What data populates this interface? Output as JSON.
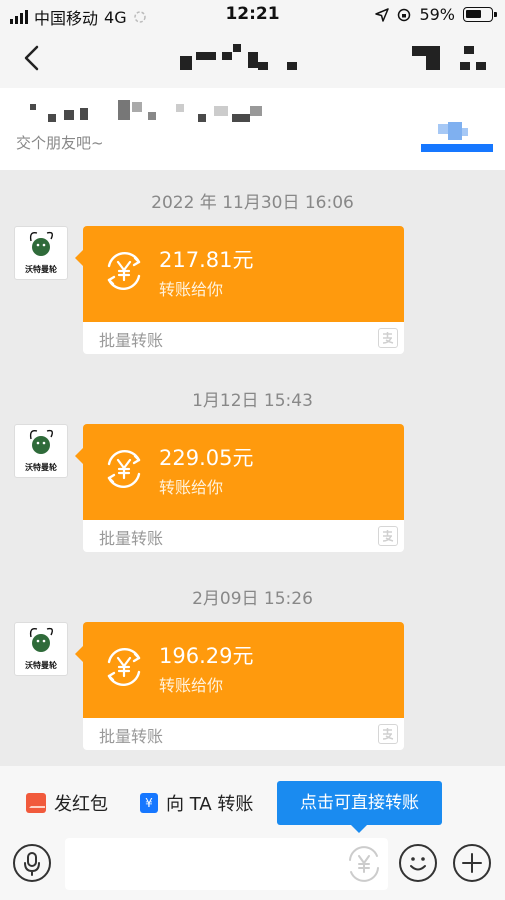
{
  "status_bar": {
    "carrier": "中国移动",
    "network": "4G",
    "time": "12:21",
    "battery": "59%"
  },
  "profile": {
    "greeting": "交个朋友吧~"
  },
  "messages": [
    {
      "timestamp": "2022 年 11月30日 16:06",
      "avatar_label": "沃特曼轮",
      "amount": "217.81元",
      "subtitle": "转账给你",
      "footer": "批量转账"
    },
    {
      "timestamp": "1月12日 15:43",
      "avatar_label": "沃特曼轮",
      "amount": "229.05元",
      "subtitle": "转账给你",
      "footer": "批量转账"
    },
    {
      "timestamp": "2月09日 15:26",
      "avatar_label": "沃特曼轮",
      "amount": "196.29元",
      "subtitle": "转账给你",
      "footer": "批量转账"
    }
  ],
  "actions": {
    "red_packet": "发红包",
    "transfer": "向 TA 转账",
    "tooltip": "点击可直接转账"
  },
  "input": {
    "placeholder": ""
  },
  "colors": {
    "accent_orange": "#ff9a0d",
    "accent_blue": "#1677ff"
  },
  "icons": {
    "back": "chevron-left-icon",
    "mic": "microphone-icon",
    "yuan": "yuan-coin-icon",
    "emoji": "emoji-icon",
    "plus": "plus-icon"
  }
}
